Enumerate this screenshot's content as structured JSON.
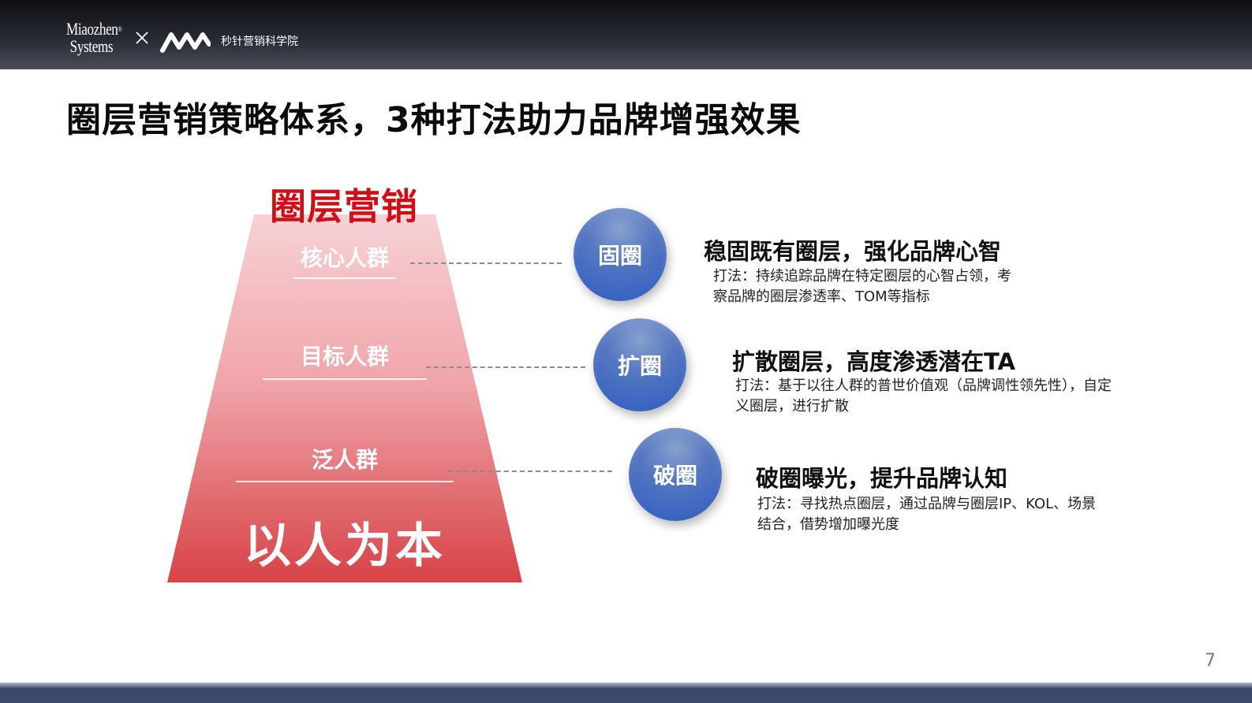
{
  "header": {
    "brand_line1": "Miaozhen",
    "brand_line2": "Systems",
    "school_name": "秒针营销科学院",
    "icons": [
      "cross-icon",
      "mv-logo-icon"
    ]
  },
  "title": "圈层营销策略体系，3种打法助力品牌增强效果",
  "pyramid": {
    "title": "圈层营销",
    "tiers": [
      "核心人群",
      "目标人群",
      "泛人群"
    ],
    "base": "以人为本",
    "colors": {
      "top": "#f6d2d5",
      "bottom": "#d64347",
      "title": "#cf0f18"
    }
  },
  "strategies": [
    {
      "circle": "固圈",
      "title": "稳固既有圈层，强化品牌心智",
      "desc_line1": "打法：持续追踪品牌在特定圈层的心智占领，考",
      "desc_line2": "察品牌的圈层渗透率、TOM等指标"
    },
    {
      "circle": "扩圈",
      "title": "扩散圈层，高度渗透潜在TA",
      "desc_line1": "打法：基于以往人群的普世价值观（品牌调性领先性），自定",
      "desc_line2": "义圈层，进行扩散"
    },
    {
      "circle": "破圈",
      "title": "破圈曝光，提升品牌认知",
      "desc_line1": "打法：寻找热点圈层，通过品牌与圈层IP、KOL、场景",
      "desc_line2": "结合，借势增加曝光度"
    }
  ],
  "circle_color": "#2e5bc2",
  "page_number": "7"
}
